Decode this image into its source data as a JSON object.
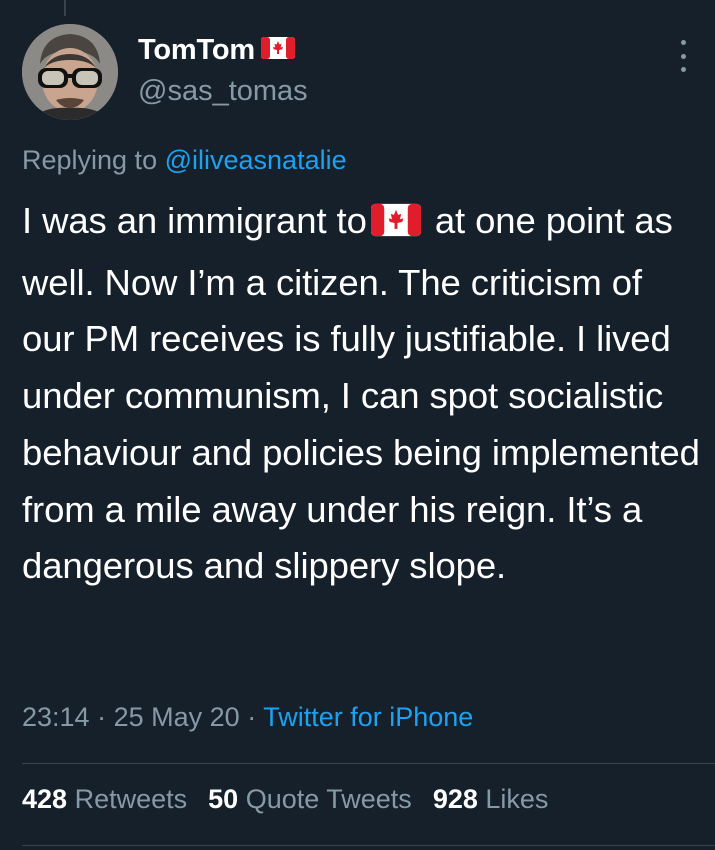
{
  "user": {
    "display_name": "TomTom",
    "handle": "@sas_tomas",
    "flag_icon": "canada-flag-icon"
  },
  "reply": {
    "prefix": "Replying to",
    "to_handle": "@iliveasnatalie"
  },
  "tweet": {
    "text_before_flag": "I was an immigrant to",
    "text_after_flag": " at one point as well. Now I’m a citizen. The criticism of our PM receives is fully justifiable. I lived under communism, I can spot socialistic behaviour and policies being implemented from a mile away under his reign. It’s a dangerous and slippery slope."
  },
  "meta": {
    "time": "23:14",
    "date": "25 May 20",
    "separator": "·",
    "source": "Twitter for iPhone"
  },
  "stats": {
    "retweets_count": "428",
    "retweets_label": "Retweets",
    "quotes_count": "50",
    "quotes_label": "Quote Tweets",
    "likes_count": "928",
    "likes_label": "Likes"
  },
  "colors": {
    "background": "#15202b",
    "secondary_text": "#8899a6",
    "link": "#1da1f2",
    "divider": "#38444d"
  }
}
